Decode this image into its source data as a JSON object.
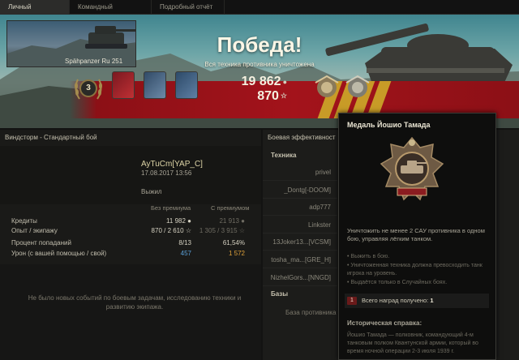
{
  "tabs": [
    {
      "label": "Личный результат",
      "active": true
    },
    {
      "label": "Командный результат",
      "active": false
    },
    {
      "label": "Подробный отчёт",
      "active": false
    }
  ],
  "banner": {
    "title": "Победа!",
    "subtitle": "Вся техника противника уничтожена",
    "rank": "3",
    "credits": "19 862",
    "experience": "870"
  },
  "left": {
    "header": "Виндсторм - Стандартный бой",
    "player": "AyTuCm[YAP_C]",
    "date": "17.08.2017 13:56",
    "tank": "Spähpanzer Ru 251",
    "status": "Выжил",
    "col_without": "Без премиума",
    "col_with": "С премиумом",
    "rows": [
      {
        "label": "Кредиты",
        "without": "11 982",
        "with": "21 913",
        "color": "#d6d2c2"
      },
      {
        "label": "Опыт / экипажу",
        "without": "870 / 2 610",
        "with": "1 305 / 3 915",
        "color": "#d6d2c2"
      },
      {
        "label": "Процент попаданий",
        "without": "8/13",
        "with": "61,54%",
        "color": "#d6d2c2"
      },
      {
        "label": "Урон (с вашей помощью / свой)",
        "without": "457",
        "with": "1 572",
        "color": "#5aa0d8",
        "color2": "#e0a23a"
      }
    ],
    "no_events": "Не было новых событий по боевым задачам, исследованию техники и развитию экипажа."
  },
  "right": {
    "header": "Боевая эффективност",
    "tech_label": "Техника",
    "players": [
      "privel",
      "_Dontg[-DOOM]",
      "adp777",
      "Linkster",
      "13Joker13...[VCSM]",
      "tosha_ma...[GRE_H]",
      "NizhelGors...[NNGD]"
    ],
    "bases_label": "Базы",
    "base_capture": "База противника"
  },
  "tooltip": {
    "title": "Медаль Йошио Тамада",
    "description": "Уничтожить не менее 2 САУ противника в одном бою, управляя лёгким танком.",
    "conditions": [
      "• Выжить в бою.",
      "• Уничтоженная техника должна превосходить танк игрока на уровень.",
      "• Выдаётся только в Случайных боях."
    ],
    "count_badge": "1",
    "count_label": "Всего наград получено:",
    "count_value": "1",
    "history_title": "Историческая справка:",
    "history_text": "Йошио Тамада — полковник, командующий 4-м танковым полком Квантунской армии, который во время ночной операции 2-3 июля 1939 г."
  }
}
